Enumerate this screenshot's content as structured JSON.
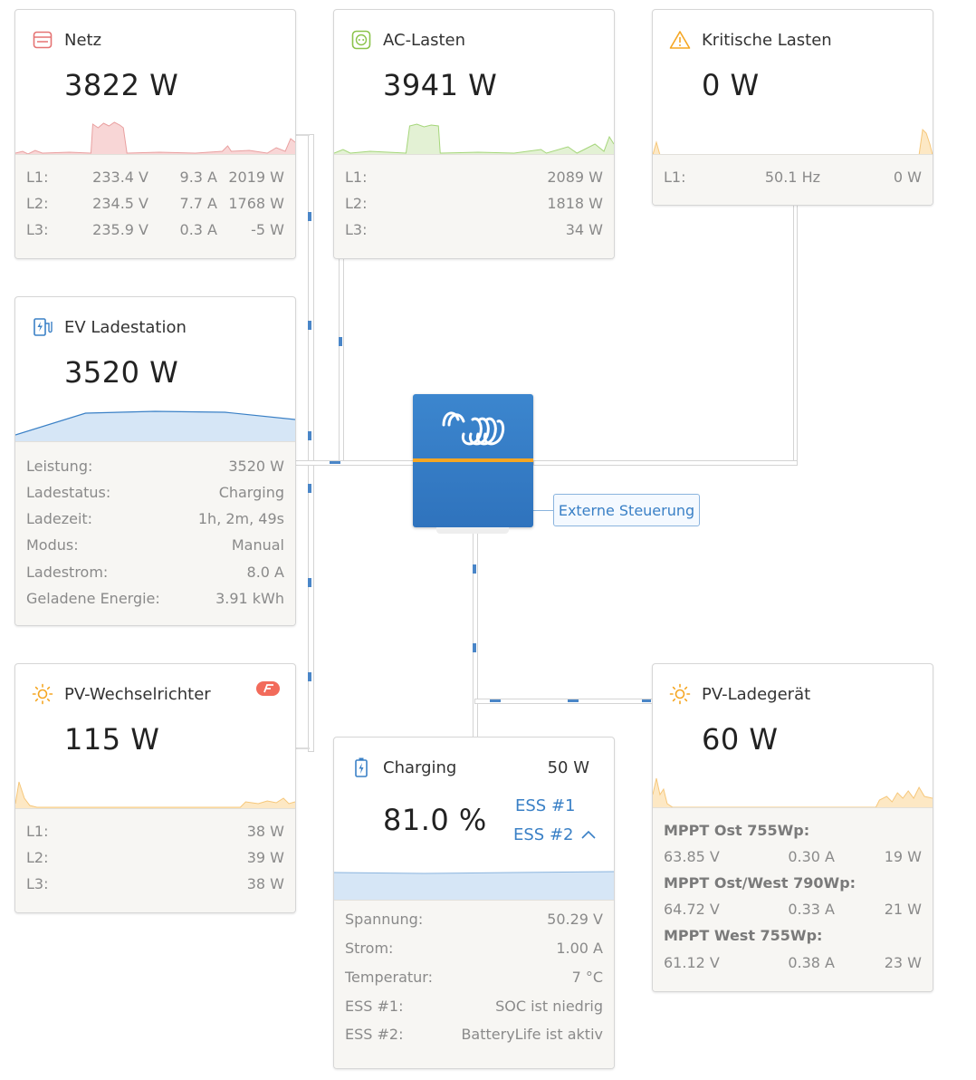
{
  "colors": {
    "grid": "#e57373",
    "acloads": "#8bc34a",
    "critical": "#f5a623",
    "ev": "#3a80c6",
    "pv": "#f5a623",
    "battery": "#3a80c6",
    "inverter_top": "#3c86ce",
    "inverter_stripe": "#f5a623"
  },
  "icons": {
    "grid": "grid-meter-icon",
    "acloads": "ac-outlet-icon",
    "critical": "warning-triangle-icon",
    "ev": "ev-charger-icon",
    "pvinverter": "sun-icon",
    "pvcharger": "sun-icon",
    "battery": "battery-charging-icon",
    "inverter": "victron-logo-icon",
    "fronius": "fronius-badge-icon"
  },
  "grid": {
    "title": "Netz",
    "power": "3822 W",
    "rows": [
      {
        "label": "L1:",
        "v": "233.4 V",
        "a": "9.3 A",
        "w": "2019 W"
      },
      {
        "label": "L2:",
        "v": "234.5 V",
        "a": "7.7 A",
        "w": "1768 W"
      },
      {
        "label": "L3:",
        "v": "235.9 V",
        "a": "0.3 A",
        "w": "-5 W"
      }
    ]
  },
  "acloads": {
    "title": "AC-Lasten",
    "power": "3941 W",
    "rows": [
      {
        "label": "L1:",
        "w": "2089 W"
      },
      {
        "label": "L2:",
        "w": "1818 W"
      },
      {
        "label": "L3:",
        "w": "34 W"
      }
    ]
  },
  "critical": {
    "title": "Kritische Lasten",
    "power": "0 W",
    "rows": [
      {
        "label": "L1:",
        "hz": "50.1 Hz",
        "w": "0 W"
      }
    ]
  },
  "ev": {
    "title": "EV Ladestation",
    "power": "3520 W",
    "rows": [
      {
        "label": "Leistung:",
        "value": "3520 W"
      },
      {
        "label": "Ladestatus:",
        "value": "Charging"
      },
      {
        "label": "Ladezeit:",
        "value": "1h, 2m, 49s"
      },
      {
        "label": "Modus:",
        "value": "Manual"
      },
      {
        "label": "Ladestrom:",
        "value": "8.0 A"
      },
      {
        "label": "Geladene Energie:",
        "value": "3.91 kWh"
      }
    ]
  },
  "pvinverter": {
    "title": "PV-Wechselrichter",
    "power": "115 W",
    "rows": [
      {
        "label": "L1:",
        "w": "38 W"
      },
      {
        "label": "L2:",
        "w": "39 W"
      },
      {
        "label": "L3:",
        "w": "38 W"
      }
    ]
  },
  "inverter": {
    "external_control": "Externe Steuerung"
  },
  "battery": {
    "title": "Charging",
    "power": "50 W",
    "soc": "81.0 %",
    "ess1": "ESS #1",
    "ess2": "ESS #2",
    "rows": [
      {
        "label": "Spannung:",
        "value": "50.29 V"
      },
      {
        "label": "Strom:",
        "value": "1.00 A"
      },
      {
        "label": "Temperatur:",
        "value": "7 °C"
      },
      {
        "label": "ESS #1:",
        "value": "SOC ist niedrig"
      },
      {
        "label": "ESS #2:",
        "value": "BatteryLife ist aktiv"
      }
    ]
  },
  "pvcharger": {
    "title": "PV-Ladegerät",
    "power": "60 W",
    "trackers": [
      {
        "name": "MPPT Ost 755Wp:",
        "v": "63.85 V",
        "a": "0.30 A",
        "w": "19 W"
      },
      {
        "name": "MPPT Ost/West 790Wp:",
        "v": "64.72 V",
        "a": "0.33 A",
        "w": "21 W"
      },
      {
        "name": "MPPT West 755Wp:",
        "v": "61.12 V",
        "a": "0.38 A",
        "w": "23 W"
      }
    ]
  }
}
